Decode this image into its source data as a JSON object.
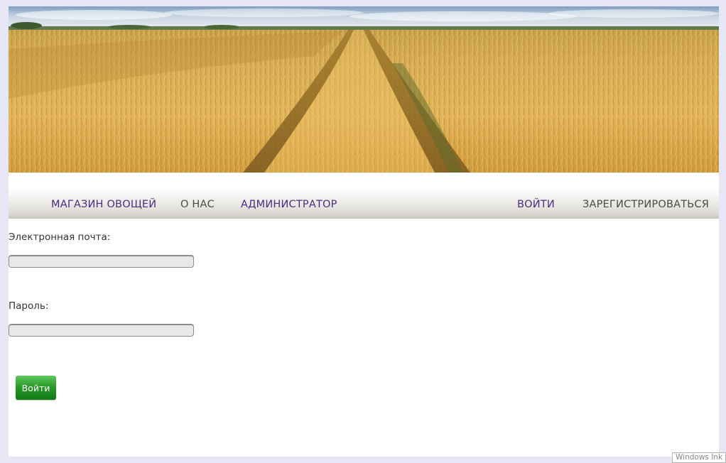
{
  "nav": {
    "shop": "МАГАЗИН ОВОЩЕЙ",
    "about": "О НАС",
    "admin": "АДМИНИСТРАТОР",
    "login": "ВОЙТИ",
    "register": "ЗАРЕГИСТРИРОВАТЬСЯ"
  },
  "form": {
    "email_label": "Электронная почта:",
    "email_value": "",
    "password_label": "Пароль:",
    "password_value": "",
    "submit_label": "Войти"
  },
  "banner": {
    "icon": "wheat-field-photo"
  },
  "taskbar": {
    "ink_label": "Windows Ink"
  },
  "colors": {
    "nav_link": "#4a2d7e",
    "nav_link_muted": "#4a4a4a",
    "button": "#2b9a2b",
    "page_background": "#e6e6f5"
  }
}
